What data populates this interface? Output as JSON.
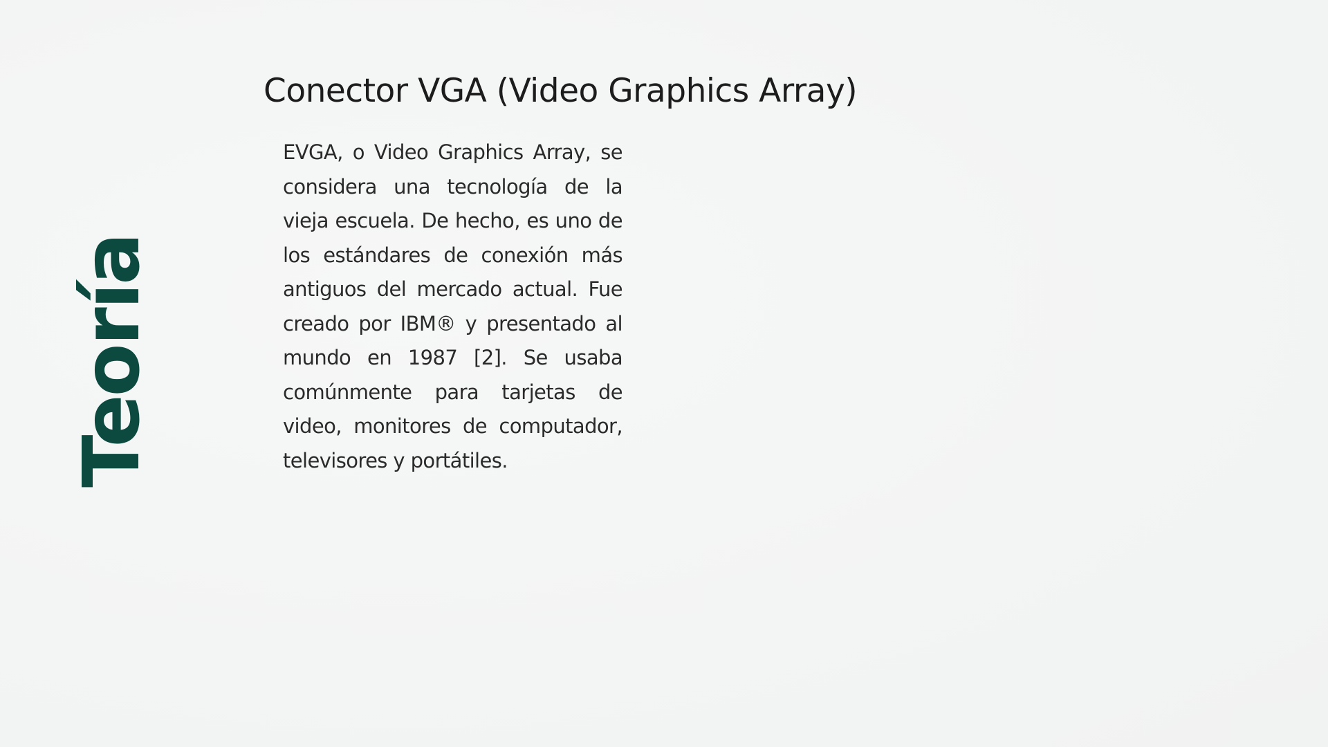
{
  "slide": {
    "section_label": "Teoría",
    "title": "Conector VGA (Video Graphics Array)",
    "body": "EVGA, o Video Graphics Array, se considera una tecnología de la vieja escuela. De hecho, es uno de los estándares de conexión más antiguos del mercado actual. Fue creado por IBM® y presentado al mundo en 1987 [2]. Se usaba comúnmente para tarjetas de video, monitores de computador, televisores y portátiles."
  },
  "colors": {
    "background": "#f3f4f4",
    "accent": "#0c4a40",
    "text": "#1c1c1c"
  }
}
